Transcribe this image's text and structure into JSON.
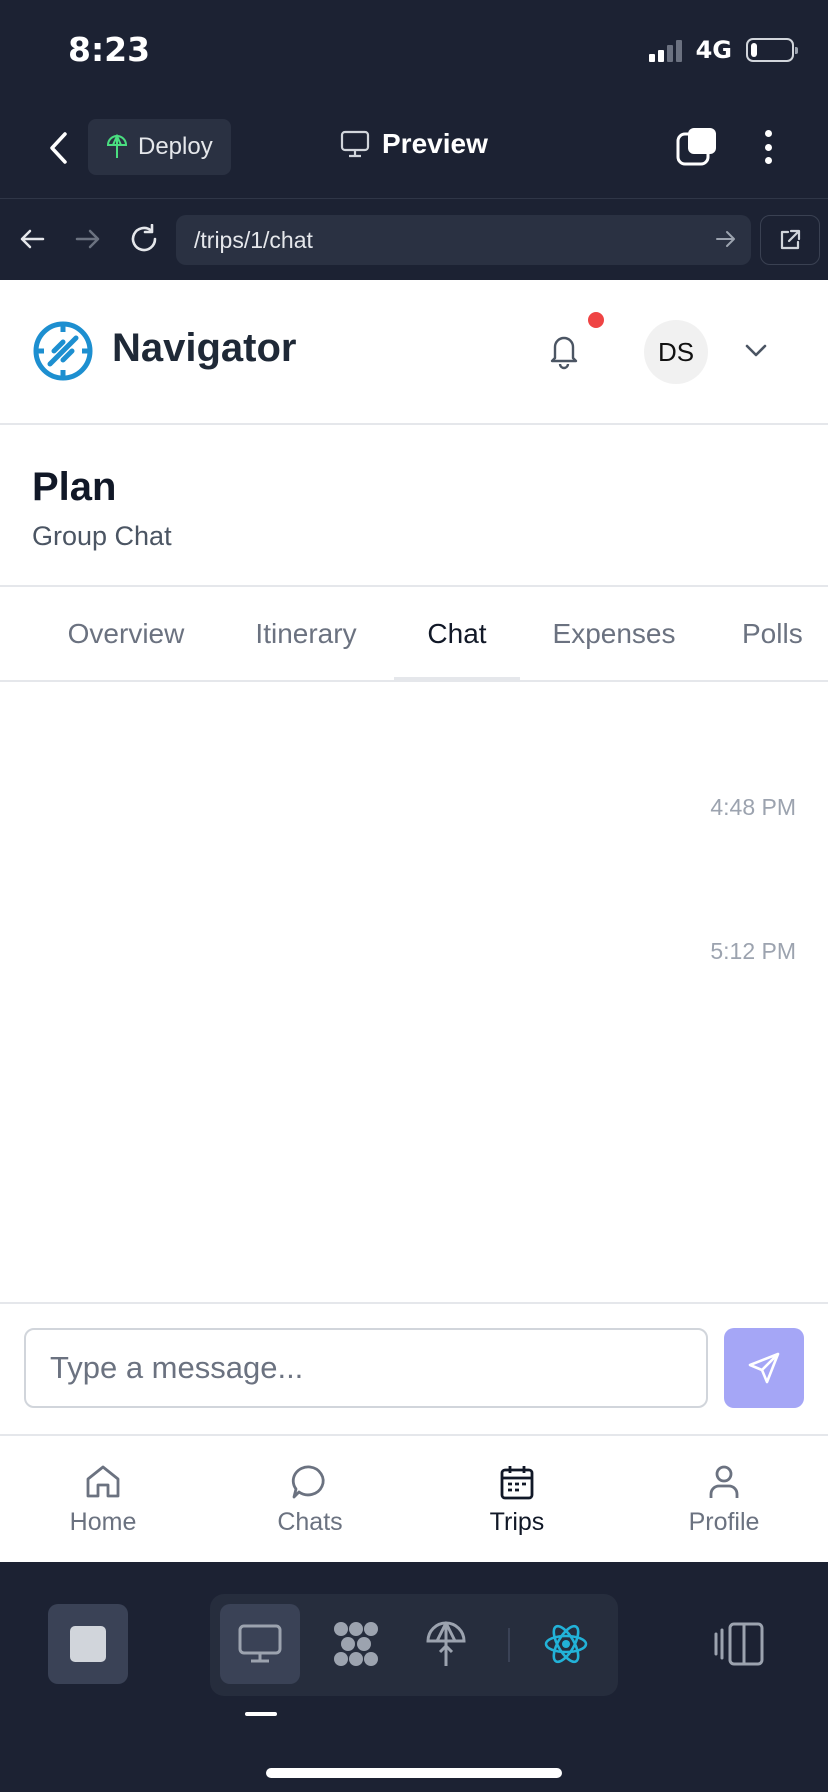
{
  "status_bar": {
    "time": "8:23",
    "network": "4G",
    "battery_percent": 15
  },
  "toolbar": {
    "deploy_label": "Deploy",
    "preview_label": "Preview"
  },
  "urlbar": {
    "url": "/trips/1/chat"
  },
  "app": {
    "brand": "Navigator",
    "avatar_initials": "DS",
    "has_notification": true,
    "accent_color": "#1d8fd0"
  },
  "trip": {
    "title": "Plan",
    "subtitle": "Group Chat"
  },
  "tabs": [
    {
      "label": "Overview",
      "active": false
    },
    {
      "label": "Itinerary",
      "active": false
    },
    {
      "label": "Chat",
      "active": true
    },
    {
      "label": "Expenses",
      "active": false
    },
    {
      "label": "Polls",
      "active": false
    }
  ],
  "messages": [
    {
      "time": "4:48 PM"
    },
    {
      "time": "5:12 PM"
    }
  ],
  "composer": {
    "placeholder": "Type a message...",
    "send_color": "#a5a6f6"
  },
  "bottom_nav": [
    {
      "label": "Home",
      "icon": "home-icon",
      "active": false
    },
    {
      "label": "Chats",
      "icon": "chat-bubble-icon",
      "active": false
    },
    {
      "label": "Trips",
      "icon": "calendar-icon",
      "active": true
    },
    {
      "label": "Profile",
      "icon": "user-icon",
      "active": false
    }
  ],
  "dock": {
    "items": [
      "stop-icon",
      "monitor-icon",
      "dots-grid-icon",
      "deploy-icon",
      "react-icon",
      "panel-icon"
    ]
  }
}
